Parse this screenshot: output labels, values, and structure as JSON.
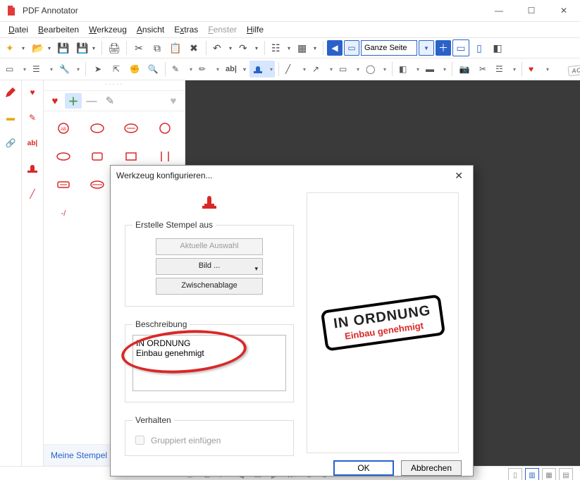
{
  "app": {
    "title": "PDF Annotator"
  },
  "menu": {
    "file": "Datei",
    "edit": "Bearbeiten",
    "tool": "Werkzeug",
    "view": "Ansicht",
    "extras": "Extras",
    "window": "Fenster",
    "help": "Hilfe"
  },
  "toolbar": {
    "page_mode": "Ganze Seite",
    "accepted_label": "ACCEPTED"
  },
  "panel": {
    "title": "Meine Stempel"
  },
  "dialog": {
    "title": "Werkzeug konfigurieren...",
    "group_create": "Erstelle Stempel aus",
    "btn_selection": "Aktuelle Auswahl",
    "btn_image": "Bild ...",
    "btn_clipboard": "Zwischenablage",
    "group_desc": "Beschreibung",
    "desc_value": "IN ORDNUNG\nEinbau genehmigt",
    "group_behavior": "Verhalten",
    "chk_grouped": "Gruppiert einfügen",
    "ok": "OK",
    "cancel": "Abbrechen",
    "preview": {
      "line1": "IN ORDNUNG",
      "line2": "Einbau genehmigt"
    }
  }
}
